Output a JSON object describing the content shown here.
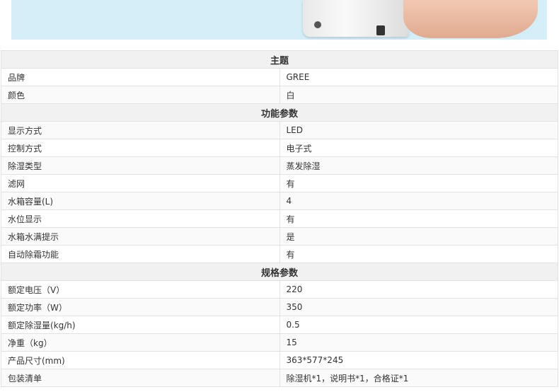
{
  "sections": [
    {
      "title": "主题",
      "rows": [
        {
          "label": "品牌",
          "value": "GREE"
        },
        {
          "label": "颜色",
          "value": "白"
        }
      ]
    },
    {
      "title": "功能参数",
      "rows": [
        {
          "label": "显示方式",
          "value": "LED"
        },
        {
          "label": "控制方式",
          "value": "电子式"
        },
        {
          "label": "除湿类型",
          "value": "蒸发除湿"
        },
        {
          "label": "滤网",
          "value": "有"
        },
        {
          "label": "水箱容量(L)",
          "value": "4"
        },
        {
          "label": "水位显示",
          "value": "有"
        },
        {
          "label": "水箱水满提示",
          "value": "是"
        },
        {
          "label": "自动除霜功能",
          "value": "有"
        }
      ]
    },
    {
      "title": "规格参数",
      "rows": [
        {
          "label": "额定电压（V）",
          "value": "220"
        },
        {
          "label": "额定功率（W）",
          "value": "350"
        },
        {
          "label": "额定除湿量(kg/h)",
          "value": "0.5"
        },
        {
          "label": "净重（kg）",
          "value": "15"
        },
        {
          "label": "产品尺寸(mm)",
          "value": "363*577*245"
        },
        {
          "label": "包装清单",
          "value": "除湿机*1，说明书*1，合格证*1"
        }
      ]
    }
  ]
}
